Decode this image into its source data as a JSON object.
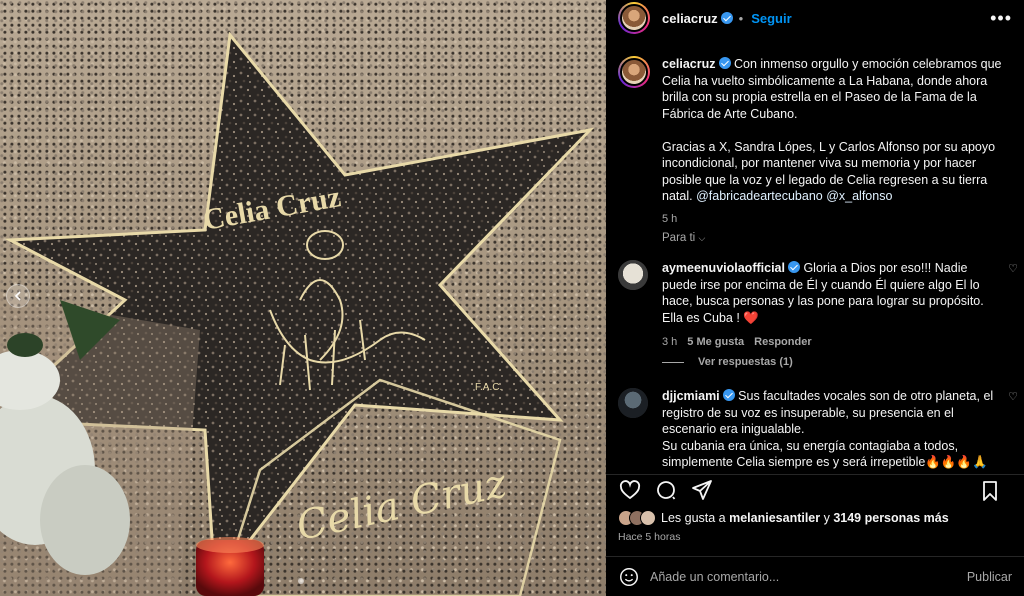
{
  "post": {
    "author": "celiacruz",
    "follow_label": "Seguir",
    "separator": "•",
    "more_label": "•••"
  },
  "caption": {
    "author": "celiacruz",
    "paragraph1": "Con inmenso orgullo y emoción celebramos que Celia ha vuelto simbólicamente a La Habana, donde ahora brilla con su propia estrella en el Paseo de la Fama de la Fábrica de Arte Cubano.",
    "paragraph2": "Gracias a X, Sandra Lópes, L y Carlos Alfonso por su apoyo incondicional, por mantener viva su memoria y por hacer posible que la voz y el legado de Celia regresen a su tierra natal.",
    "mentions": "@fabricadeartecubano @x_alfonso",
    "time": "5 h",
    "translate_label": "Para ti"
  },
  "comments": [
    {
      "author": "aymeenuviolaofficial",
      "text": "Gloria a Dios por eso!!! Nadie puede irse por encima de Él y cuando Él quiere algo El lo hace, busca personas y las pone para lograr su propósito. Ella es Cuba ! ❤️",
      "time": "3 h",
      "likes": "5 Me gusta",
      "reply_label": "Responder",
      "view_replies": "Ver respuestas (1)"
    },
    {
      "author": "djjcmiami",
      "text": "Sus facultades vocales son de otro planeta, el registro de su voz es insuperable, su presencia en el escenario era inigualable.",
      "text2": "Su cubania era única, su energía contagiaba a todos, simplemente Celia siempre es y será irrepetible🔥🔥🔥🙏"
    }
  ],
  "likes": {
    "prefix": "Les gusta a ",
    "user": "melaniesantiler",
    "middle": " y ",
    "count": "3149 personas más"
  },
  "posted": "Hace 5 horas",
  "comment_box": {
    "placeholder": "Añade un comentario...",
    "publish_label": "Publicar"
  },
  "photo": {
    "star_name": "Celia Cruz",
    "star_mark": "F.A.C.",
    "signature": "Celia Cruz"
  },
  "colors": {
    "accent": "#0095f6",
    "background": "#000000",
    "muted": "#a8a8a8",
    "verified": "#3897f0",
    "star_gold": "#e8d9a8"
  },
  "icons": [
    "heart-icon",
    "comment-icon",
    "share-icon",
    "bookmark-icon",
    "emoji-icon",
    "more-icon",
    "verified-badge-icon"
  ]
}
